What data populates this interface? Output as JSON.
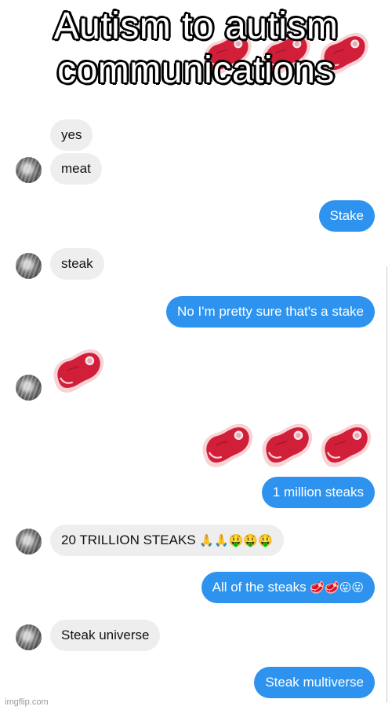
{
  "caption": {
    "line1": "Autism to autism",
    "line2": "communications"
  },
  "messages": [
    {
      "from": "other",
      "text": "yes"
    },
    {
      "from": "other",
      "text": "meat"
    },
    {
      "from": "me",
      "text": "Stake"
    },
    {
      "from": "other",
      "text": "steak"
    },
    {
      "from": "me",
      "text": "No I'm pretty sure that's a stake"
    },
    {
      "from": "other",
      "emoji": "steak-emoji",
      "count": 1
    },
    {
      "from": "me",
      "emoji": "steak-emoji",
      "count": 3
    },
    {
      "from": "me",
      "text": "1 million steaks"
    },
    {
      "from": "other",
      "text": "20 TRILLION STEAKS",
      "emoji_suffix": "🙏🙏🤑🤑🤑"
    },
    {
      "from": "me",
      "text": "All of the steaks",
      "emoji_suffix": "🥩🥩😛😛"
    },
    {
      "from": "other",
      "text": "Steak universe"
    },
    {
      "from": "me",
      "text": "Steak multiverse"
    }
  ],
  "watermark": "imgflip.com",
  "colors": {
    "outgoing_bubble": "#2d93ef",
    "incoming_bubble": "#eeeeee",
    "steak_meat": "#d11f3a",
    "steak_fat": "#f7d3d6"
  }
}
